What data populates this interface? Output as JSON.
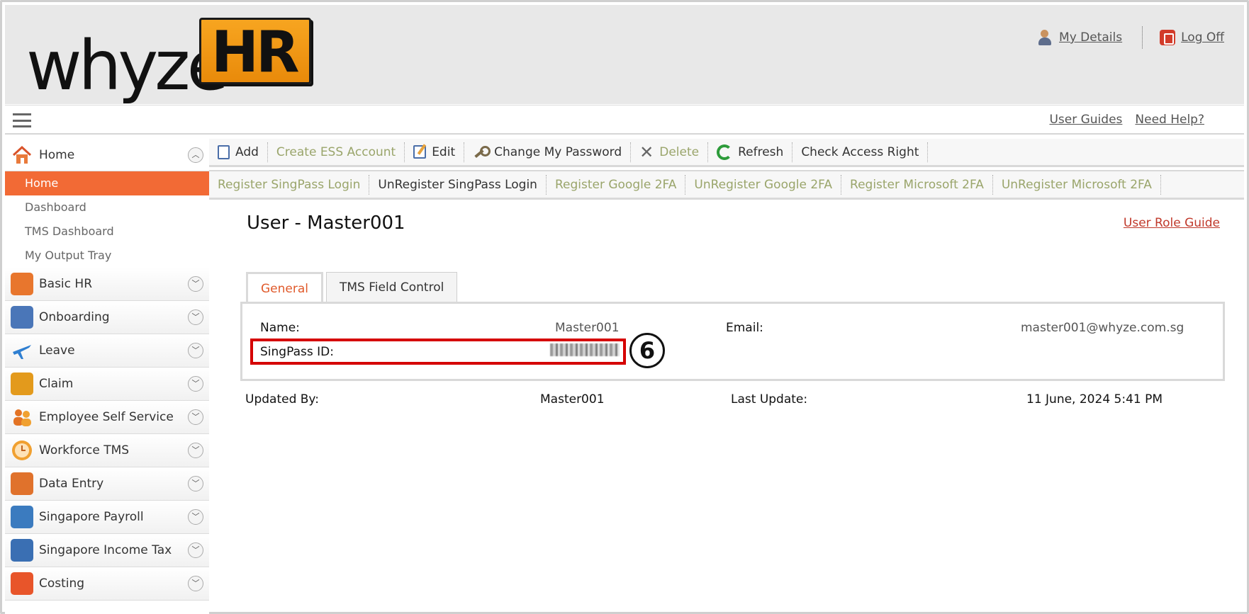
{
  "brand": {
    "logo_word": "whyze",
    "logo_box": "HR"
  },
  "header": {
    "my_details": "My Details",
    "log_off": "Log Off"
  },
  "subbar": {
    "user_guides": "User Guides",
    "need_help": "Need Help?"
  },
  "sidebar": {
    "home_section": "Home",
    "home_items": [
      "Home",
      "Dashboard",
      "TMS Dashboard",
      "My Output Tray"
    ],
    "modules": [
      {
        "label": "Basic HR",
        "icon": "folder-icon",
        "color": "#e8762d"
      },
      {
        "label": "Onboarding",
        "icon": "onboarding-icon",
        "color": "#4a76b8"
      },
      {
        "label": "Leave",
        "icon": "airplane-icon",
        "color": "#2f7fd1"
      },
      {
        "label": "Claim",
        "icon": "wallet-icon",
        "color": "#e39a1c"
      },
      {
        "label": "Employee Self Service",
        "icon": "people-icon",
        "color": "#e37324"
      },
      {
        "label": "Workforce TMS",
        "icon": "clock-icon",
        "color": "#f0a030"
      },
      {
        "label": "Data Entry",
        "icon": "keyboard-icon",
        "color": "#e0722c"
      },
      {
        "label": "Singapore Payroll",
        "icon": "payroll-icon",
        "color": "#3b7bbf"
      },
      {
        "label": "Singapore Income Tax",
        "icon": "calculator-icon",
        "color": "#3a6fb3"
      },
      {
        "label": "Costing",
        "icon": "costing-icon",
        "color": "#e8552a"
      }
    ]
  },
  "toolbar1": {
    "add": "Add",
    "create_ess": "Create ESS Account",
    "edit": "Edit",
    "change_password": "Change My Password",
    "delete": "Delete",
    "refresh": "Refresh",
    "check_access": "Check Access Right"
  },
  "toolbar2": {
    "register_singpass": "Register SingPass Login",
    "unregister_singpass": "UnRegister SingPass Login",
    "register_google": "Register Google 2FA",
    "unregister_google": "UnRegister Google 2FA",
    "register_ms": "Register Microsoft 2FA",
    "unregister_ms": "UnRegister Microsoft 2FA"
  },
  "page": {
    "title": "User - Master001",
    "role_guide": "User Role Guide",
    "tabs": [
      "General",
      "TMS Field Control"
    ]
  },
  "general": {
    "name_label": "Name:",
    "name_value": "Master001",
    "email_label": "Email:",
    "email_value": "master001@whyze.com.sg",
    "singpass_label": "SingPass ID:",
    "callout": "6"
  },
  "meta": {
    "updated_by_label": "Updated By:",
    "updated_by_value": "Master001",
    "last_update_label": "Last Update:",
    "last_update_value": "11 June, 2024 5:41 PM"
  },
  "colors": {
    "accent_orange": "#f26a35",
    "highlight_red": "#d50000",
    "disabled_text": "#9aa56b"
  }
}
